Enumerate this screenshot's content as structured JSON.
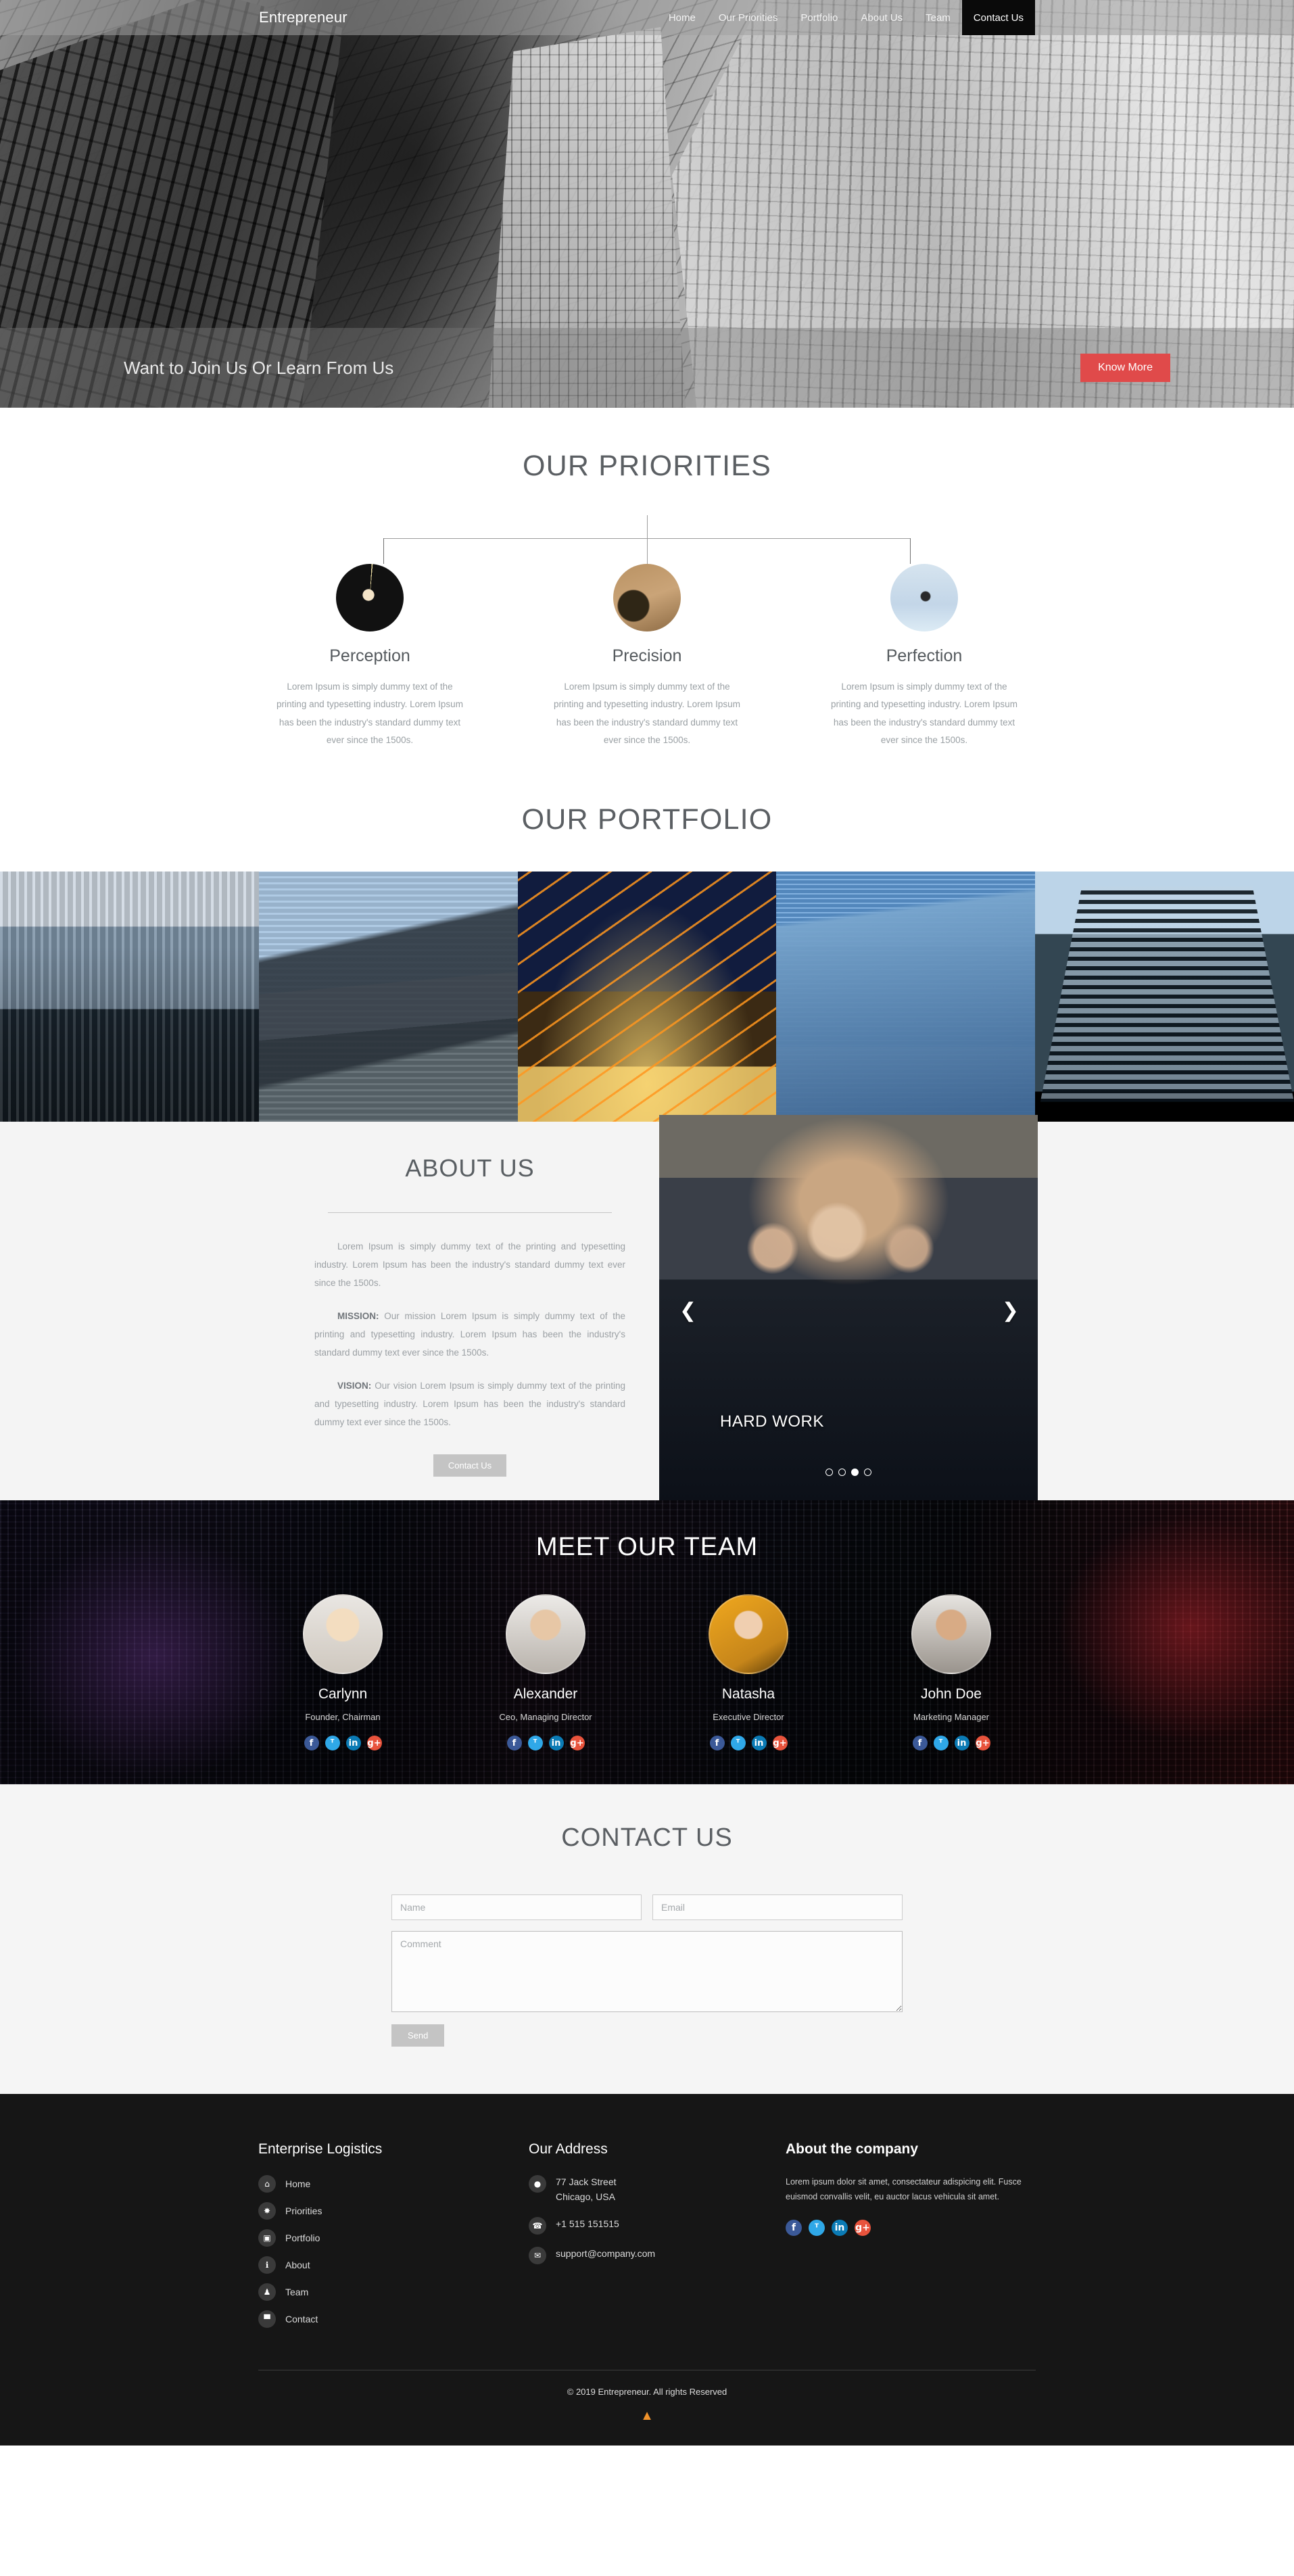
{
  "nav": {
    "brand": "Entrepreneur",
    "links": [
      {
        "label": "Home",
        "active": false
      },
      {
        "label": "Our Priorities",
        "active": false
      },
      {
        "label": "Portfolio",
        "active": false
      },
      {
        "label": "About Us",
        "active": false
      },
      {
        "label": "Team",
        "active": false
      },
      {
        "label": "Contact Us",
        "active": true
      }
    ]
  },
  "hero": {
    "caption": "Want to Join Us Or Learn From Us",
    "cta_label": "Know More",
    "cta_color": "#e04a4a"
  },
  "priorities": {
    "title": "OUR PRIORITIES",
    "cards": [
      {
        "name": "Perception",
        "text": "Lorem Ipsum is simply dummy text of the printing and typesetting industry. Lorem Ipsum has been the industry's standard dummy text ever since the 1500s.",
        "image": "welder-grinding-sparks-photo"
      },
      {
        "name": "Precision",
        "text": "Lorem Ipsum is simply dummy text of the printing and typesetting industry. Lorem Ipsum has been the industry's standard dummy text ever since the 1500s.",
        "image": "soldier-with-rifle-photo"
      },
      {
        "name": "Perfection",
        "text": "Lorem Ipsum is simply dummy text of the printing and typesetting industry. Lorem Ipsum has been the industry's standard dummy text ever since the 1500s.",
        "image": "motocross-jump-sky-photo"
      }
    ]
  },
  "portfolio": {
    "title": "OUR PORTFOLIO",
    "items": [
      {
        "image": "city-skyline-towers-photo"
      },
      {
        "image": "glass-skyscraper-clouds-photo"
      },
      {
        "image": "orange-lit-building-night-photo"
      },
      {
        "image": "blue-glass-office-tower-photo"
      },
      {
        "image": "dark-curved-highrise-photo"
      }
    ]
  },
  "about": {
    "title": "ABOUT US",
    "paragraphs": [
      {
        "lead": "",
        "text": "Lorem Ipsum is simply dummy text of the printing and typesetting industry. Lorem Ipsum has been the industry's standard dummy text ever since the 1500s."
      },
      {
        "lead": "MISSION:",
        "text": " Our mission Lorem Ipsum is simply dummy text of the printing and typesetting industry. Lorem Ipsum has been the industry's standard dummy text ever since the 1500s."
      },
      {
        "lead": "VISION:",
        "text": " Our vision Lorem Ipsum is simply dummy text of the printing and typesetting industry. Lorem Ipsum has been the industry's standard dummy text ever since the 1500s."
      }
    ],
    "button_label": "Contact Us",
    "slider": {
      "caption": "HARD WORK",
      "image": "businessmen-handshake-photo",
      "prev_icon": "chevron-left-icon",
      "next_icon": "chevron-right-icon",
      "dot_count": 4,
      "active_dot": 3
    }
  },
  "team": {
    "title": "MEET OUR TEAM",
    "members": [
      {
        "name": "Carlynn",
        "role": "Founder, Chairman",
        "photo": "blonde-woman-portrait-photo"
      },
      {
        "name": "Alexander",
        "role": "Ceo, Managing Director",
        "photo": "bearded-man-portrait-photo"
      },
      {
        "name": "Natasha",
        "role": "Executive Director",
        "photo": "brunette-woman-portrait-photo"
      },
      {
        "name": "John Doe",
        "role": "Marketing Manager",
        "photo": "man-striped-shirt-portrait-photo"
      }
    ],
    "socials": [
      {
        "name": "facebook",
        "glyph": "f",
        "color": "#3b5998"
      },
      {
        "name": "twitter",
        "glyph": "ᵀ",
        "color": "#2fa8e8"
      },
      {
        "name": "linkedin",
        "glyph": "in",
        "color": "#0b7bb5"
      },
      {
        "name": "google-plus",
        "glyph": "g+",
        "color": "#e8533c"
      }
    ]
  },
  "contact": {
    "title": "CONTACT US",
    "name_placeholder": "Name",
    "name_value": "",
    "email_placeholder": "Email",
    "email_value": "",
    "comment_placeholder": "Comment",
    "comment_value": "",
    "send_label": "Send"
  },
  "footer": {
    "links_heading": "Enterprise Logistics",
    "links": [
      {
        "label": "Home",
        "icon": "home-icon",
        "glyph": "⌂"
      },
      {
        "label": "Priorities",
        "icon": "star-burst-icon",
        "glyph": "✸"
      },
      {
        "label": "Portfolio",
        "icon": "briefcase-icon",
        "glyph": "▣"
      },
      {
        "label": "About",
        "icon": "info-icon",
        "glyph": "ℹ"
      },
      {
        "label": "Team",
        "icon": "user-icon",
        "glyph": "♟"
      },
      {
        "label": "Contact",
        "icon": "mobile-icon",
        "glyph": "▀"
      }
    ],
    "address_heading": "Our Address",
    "address_line1": "77 Jack Street",
    "address_line2": "Chicago, USA",
    "phone": "+1 515 151515",
    "email": "support@company.com",
    "address_icons": {
      "location": "map-pin-icon",
      "phone": "phone-icon",
      "email": "envelope-icon"
    },
    "about_heading": "About the company",
    "about_text": "Lorem ipsum dolor sit amet, consectateur adispicing elit. Fusce euismod convallis velit, eu auctor lacus vehicula sit amet.",
    "socials": [
      {
        "name": "facebook",
        "glyph": "f",
        "color": "#4267b2"
      },
      {
        "name": "twitter",
        "glyph": "ᵀ",
        "color": "#2fa8e8"
      },
      {
        "name": "linkedin",
        "glyph": "in",
        "color": "#0b7bb5"
      },
      {
        "name": "google-plus",
        "glyph": "g+",
        "color": "#e8533c"
      }
    ],
    "copyright": "© 2019 Entrepreneur. All rights Reserved",
    "to_top_icon": "chevron-up-icon",
    "to_top_color": "#f0922b"
  }
}
